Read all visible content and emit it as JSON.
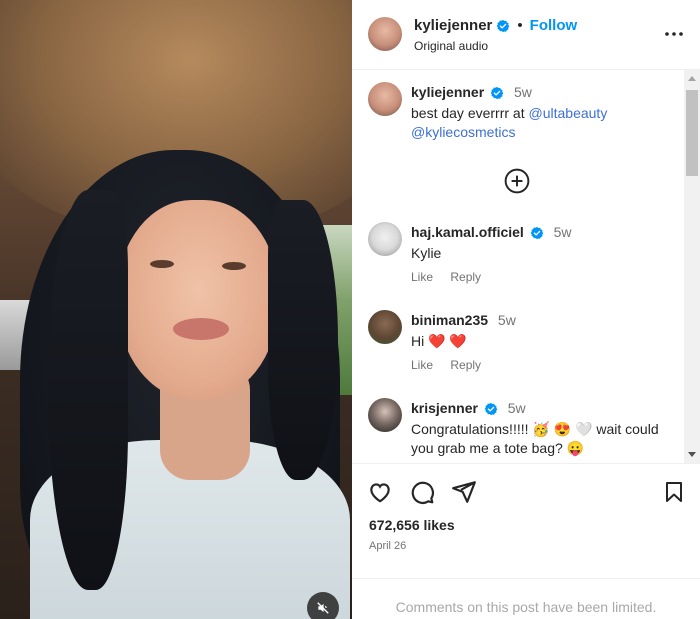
{
  "post": {
    "username": "kyliejenner",
    "follow_label": "Follow",
    "separator": "•",
    "audio_label": "Original audio"
  },
  "caption": {
    "username": "kyliejenner",
    "time": "5w",
    "text_prefix": "best day everrrr at ",
    "mention1": "@ultabeauty",
    "mention2": "@kyliecosmetics"
  },
  "comments": [
    {
      "username": "haj.kamal.officiel",
      "verified": true,
      "time": "5w",
      "text": "Kylie",
      "like_label": "Like",
      "reply_label": "Reply"
    },
    {
      "username": "biniman235",
      "verified": false,
      "time": "5w",
      "text": "Hi ❤️ ❤️",
      "like_label": "Like",
      "reply_label": "Reply"
    },
    {
      "username": "krisjenner",
      "verified": true,
      "time": "5w",
      "text": "Congratulations!!!!! 🥳 😍 🤍 wait could you grab me a tote bag? 😛"
    }
  ],
  "likes_text": "672,656 likes",
  "date_text": "April 26",
  "comments_limited": "Comments on this post have been limited.",
  "colors": {
    "accent": "#0095f6",
    "mention": "#3d6fd6",
    "verified": "#0095f6",
    "muted_text": "#737373"
  },
  "icons": [
    "verified-badge-icon",
    "more-options-icon",
    "plus-circle-icon",
    "heart-icon",
    "comment-icon",
    "share-icon",
    "bookmark-icon",
    "muted-speaker-icon"
  ]
}
